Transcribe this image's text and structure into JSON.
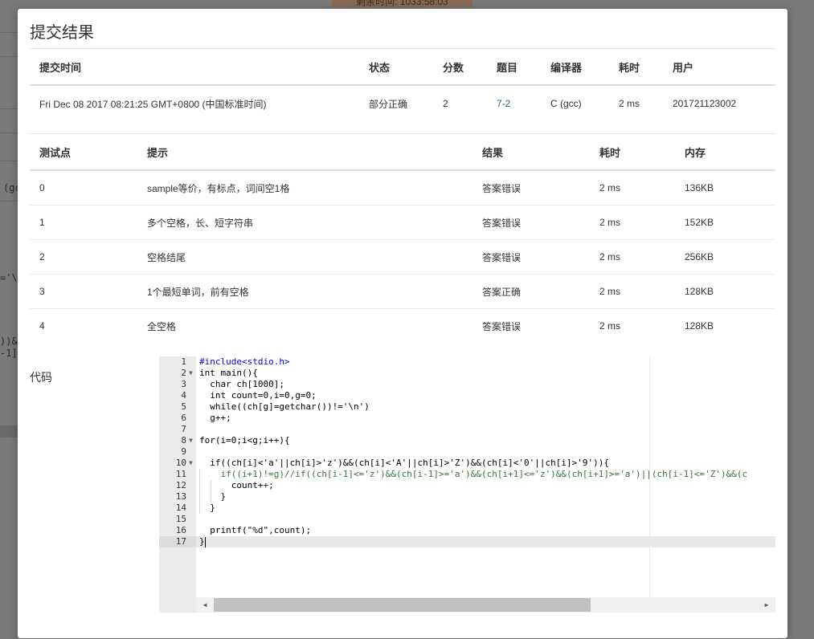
{
  "background": {
    "timer_text": "剩余时间: 1033:58:03",
    "fragments": [
      "(gc",
      "='\\n",
      "))&&",
      "-1]<"
    ]
  },
  "modal": {
    "title": "提交结果",
    "summary": {
      "headers": [
        "提交时间",
        "状态",
        "分数",
        "题目",
        "编译器",
        "耗时",
        "用户"
      ],
      "row": {
        "time": "Fri Dec 08 2017 08:21:25 GMT+0800 (中国标准时间)",
        "status": "部分正确",
        "score": "2",
        "problem": "7-2",
        "compiler": "C (gcc)",
        "duration": "2 ms",
        "user": "201721123002"
      }
    },
    "tests": {
      "headers": [
        "测试点",
        "提示",
        "结果",
        "耗时",
        "内存"
      ],
      "rows": [
        {
          "id": "0",
          "hint": "sample等价，有标点，词间空1格",
          "result": "答案错误",
          "time": "2 ms",
          "memory": "136KB"
        },
        {
          "id": "1",
          "hint": "多个空格，长、短字符串",
          "result": "答案错误",
          "time": "2 ms",
          "memory": "152KB"
        },
        {
          "id": "2",
          "hint": "空格结尾",
          "result": "答案错误",
          "time": "2 ms",
          "memory": "256KB"
        },
        {
          "id": "3",
          "hint": "1个最短单词，前有空格",
          "result": "答案正确",
          "time": "2 ms",
          "memory": "128KB"
        },
        {
          "id": "4",
          "hint": "全空格",
          "result": "答案错误",
          "time": "2 ms",
          "memory": "128KB"
        }
      ]
    },
    "code_label": "代码"
  },
  "editor": {
    "line_numbers": [
      "1",
      "2",
      "3",
      "4",
      "5",
      "6",
      "7",
      "8",
      "9",
      "10",
      "11",
      "12",
      "13",
      "14",
      "15",
      "16",
      "17"
    ],
    "lines": [
      "#include<stdio.h>",
      "int main(){",
      "  char ch[1000];",
      "  int count=0,i=0,g=0;",
      "  while((ch[g]=getchar())!='\\n')",
      "  g++;",
      "",
      "for(i=0;i<g;i++){",
      "",
      "  if((ch[i]<'a'||ch[i]>'z')&&(ch[i]<'A'||ch[i]>'Z')&&(ch[i]<'0'||ch[i]>'9')){",
      "    if((i+1)!=g)//if((ch[i-1]<='z')&&(ch[i-1]>='a')&&(ch[i+1]<='z')&&(ch[i+1]>='a')||(ch[i-1]<='Z')&&(c",
      "      count++;",
      "    }",
      "  }",
      "",
      "  printf(\"%d\",count);",
      "}"
    ],
    "scroll_left_icon": "triangle-left",
    "scroll_right_icon": "triangle-right"
  },
  "colors": {
    "status_partial": "#4cae4c",
    "wrong_answer": "#4cae4c",
    "accepted": "#e2514c",
    "problem_link": "#2a6496"
  }
}
